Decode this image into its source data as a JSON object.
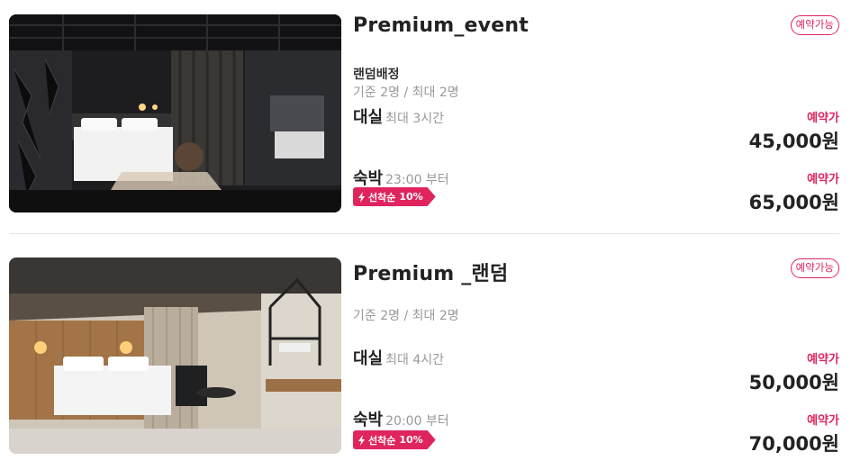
{
  "colors": {
    "accent": "#e0245e",
    "muted": "#999999",
    "text": "#222222"
  },
  "rooms": [
    {
      "title": "Premium_event",
      "status": "예약가능",
      "assign": "랜덤배정",
      "capacity": "기준 2명 / 최대 2명",
      "rent": {
        "kind": "대실",
        "detail": "최대 3시간",
        "label": "예약가",
        "price": "45,000원"
      },
      "night": {
        "kind": "숙박",
        "detail": "23:00 부터",
        "label": "예약가",
        "price": "65,000원"
      },
      "coupon": {
        "icon": "lightning-icon",
        "text": "선착순",
        "pct": "10%"
      }
    },
    {
      "title": "Premium _랜덤",
      "status": "예약가능",
      "assign": "",
      "capacity": "기준 2명 / 최대 2명",
      "rent": {
        "kind": "대실",
        "detail": "최대 4시간",
        "label": "예약가",
        "price": "50,000원"
      },
      "night": {
        "kind": "숙박",
        "detail": "20:00 부터",
        "label": "예약가",
        "price": "70,000원"
      },
      "coupon": {
        "icon": "lightning-icon",
        "text": "선착순",
        "pct": "10%"
      }
    }
  ]
}
